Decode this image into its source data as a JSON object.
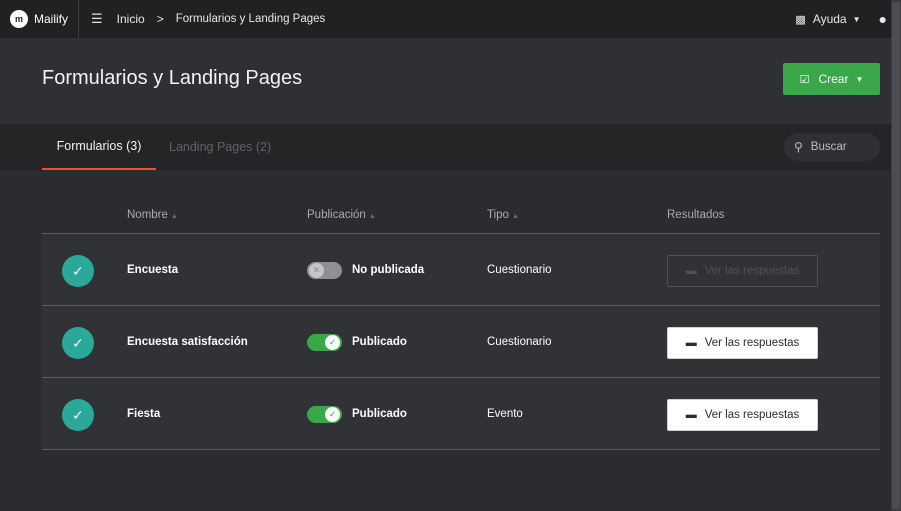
{
  "topbar": {
    "brand_initial": "m",
    "brand_name": "Mailify",
    "menu_icon": "hamburger-icon",
    "breadcrumb_home": "Inicio",
    "breadcrumb_sep": ">",
    "breadcrumb_current": "Formularios y Landing Pages",
    "help_label": "Ayuda"
  },
  "header": {
    "title": "Formularios y Landing Pages",
    "create_label": "Crear"
  },
  "tabs": [
    {
      "label": "Formularios (3)",
      "active": true
    },
    {
      "label": "Landing Pages (2)",
      "active": false
    }
  ],
  "search": {
    "placeholder": "Buscar"
  },
  "table": {
    "columns": [
      "Nombre",
      "Publicación",
      "Tipo",
      "Resultados"
    ],
    "rows": [
      {
        "name": "Encuesta",
        "published": false,
        "status": "No publicada",
        "type": "Cuestionario",
        "results_label": "Ver las respuestas",
        "results_enabled": false
      },
      {
        "name": "Encuesta satisfacción",
        "published": true,
        "status": "Publicado",
        "type": "Cuestionario",
        "results_label": "Ver las respuestas",
        "results_enabled": true
      },
      {
        "name": "Fiesta",
        "published": true,
        "status": "Publicado",
        "type": "Evento",
        "results_label": "Ver las respuestas",
        "results_enabled": true
      }
    ]
  },
  "colors": {
    "accent_green": "#3aa84a",
    "tab_underline": "#e8552a",
    "row_icon": "#2aa89a"
  }
}
